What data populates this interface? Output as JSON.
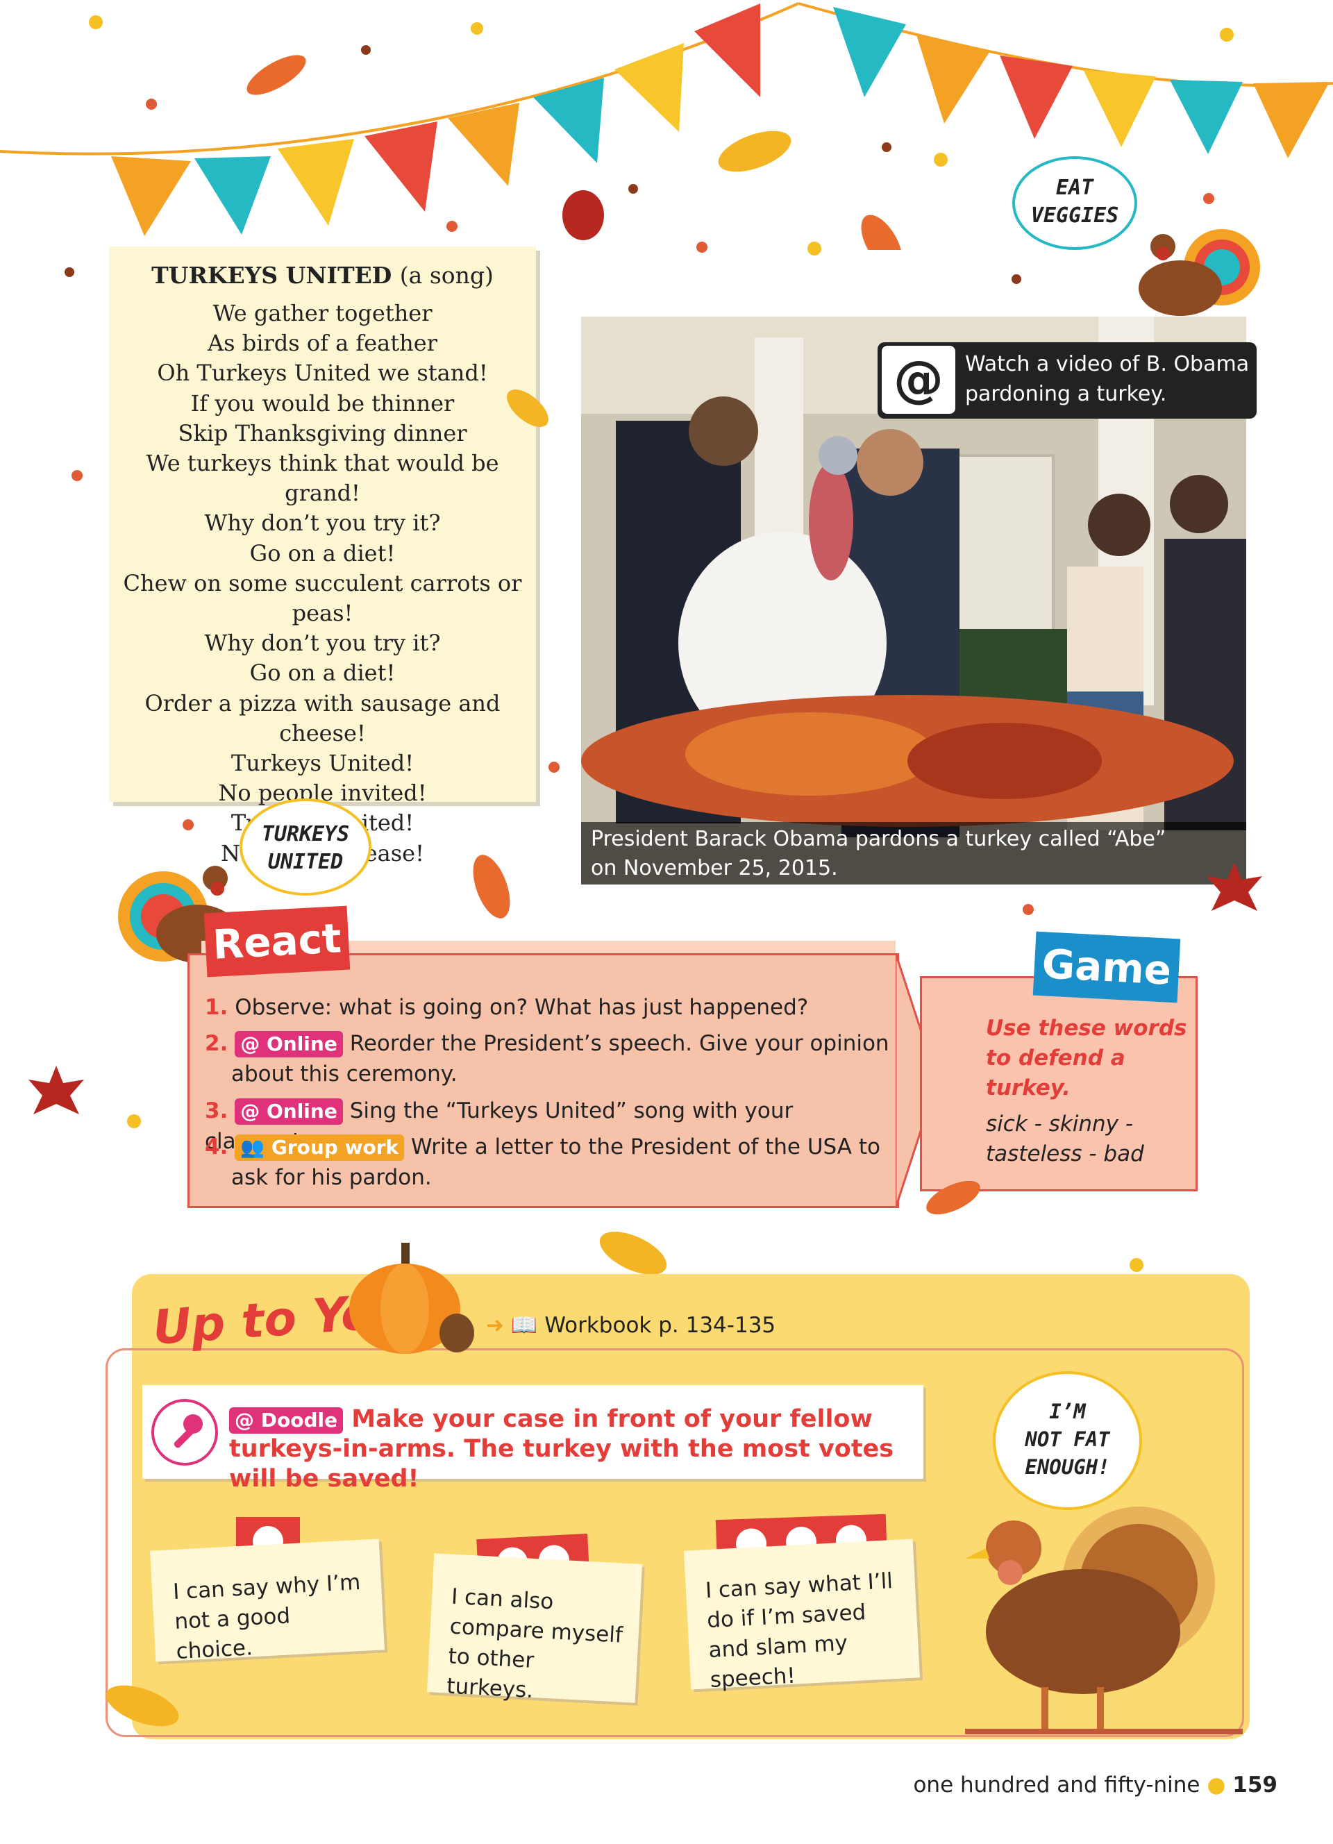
{
  "song": {
    "title": "TURKEYS UNITED",
    "subtitle": "(a song)",
    "lines": [
      "We gather together",
      "As birds of a feather",
      "Oh Turkeys United we stand!",
      "If you would be thinner",
      "Skip Thanksgiving dinner",
      "We turkeys think that would be grand!",
      "Why don’t you try it?",
      "Go on a diet!",
      "Chew on some succulent carrots or peas!",
      "Why don’t you try it?",
      "Go on a diet!",
      "Order a pizza with sausage and cheese!",
      "Turkeys United!",
      "No people invited!",
      "Turkeys United!",
      "No people please!"
    ]
  },
  "bubbles": {
    "eat_veggies": [
      "EAT",
      "VEGGIES"
    ],
    "turkeys_united": [
      "TURKEYS",
      "UNITED"
    ],
    "not_fat": [
      "I’M",
      "NOT FAT",
      "ENOUGH!"
    ]
  },
  "photo": {
    "video_at": "@",
    "video_text": "Watch a video of B. Obama pardoning a turkey.",
    "caption_line1": "President Barack Obama pardons a turkey called “Abe”",
    "caption_line2": "on November 25, 2015."
  },
  "react": {
    "title": "React",
    "items": [
      {
        "num": "1.",
        "tag": "",
        "text": "Observe: what is going on? What has just happened?"
      },
      {
        "num": "2.",
        "tag": "@ Online",
        "text": "Reorder the President’s speech. Give your opinion",
        "text2": "about this ceremony."
      },
      {
        "num": "3.",
        "tag": "@ Online",
        "text": "Sing the “Turkeys United” song with your classmates."
      },
      {
        "num": "4.",
        "tag": "Group work",
        "text": "Write a letter to the President of the USA to",
        "text2": "ask for his pardon."
      }
    ]
  },
  "game": {
    "title": "Game",
    "intro": "Use these words to defend a turkey.",
    "words": "sick - skinny - tasteless - bad"
  },
  "up": {
    "title": "Up to You!",
    "workbook": "Workbook p. 134-135",
    "doodle_tag": "@ Doodle",
    "doodle_text": "Make your case in front of your fellow turkeys-in-arms. The turkey with the most votes will be saved!",
    "notes": [
      {
        "turkeys": 1,
        "text": "I can say why I’m not a good choice."
      },
      {
        "turkeys": 2,
        "text": "I can also compare myself to other turkeys."
      },
      {
        "turkeys": 3,
        "text": "I can say what I’ll do if I’m saved and slam my speech!"
      }
    ]
  },
  "footer": {
    "text": "one hundred and fifty-nine",
    "bullet": "●",
    "page": "159"
  },
  "colors": {
    "red": "#e33d39",
    "pink": "#e0327a",
    "blue": "#1a8fc9",
    "orange": "#f4a224",
    "yellow": "#fcda72"
  }
}
